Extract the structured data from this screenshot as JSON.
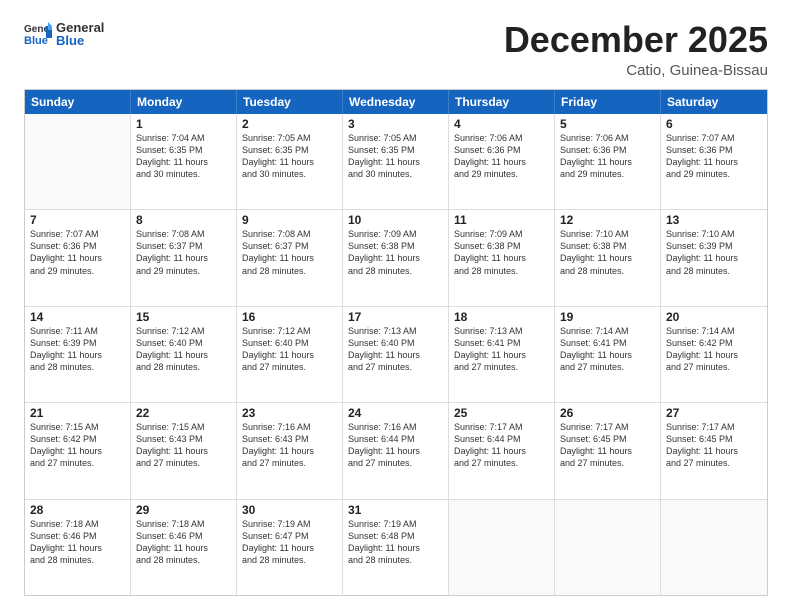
{
  "logo": {
    "general": "General",
    "blue": "Blue"
  },
  "header": {
    "month": "December 2025",
    "location": "Catio, Guinea-Bissau"
  },
  "weekdays": [
    "Sunday",
    "Monday",
    "Tuesday",
    "Wednesday",
    "Thursday",
    "Friday",
    "Saturday"
  ],
  "rows": [
    [
      {
        "day": "",
        "sunrise": "",
        "sunset": "",
        "daylight": "",
        "empty": true
      },
      {
        "day": "1",
        "sunrise": "Sunrise: 7:04 AM",
        "sunset": "Sunset: 6:35 PM",
        "daylight": "Daylight: 11 hours and 30 minutes."
      },
      {
        "day": "2",
        "sunrise": "Sunrise: 7:05 AM",
        "sunset": "Sunset: 6:35 PM",
        "daylight": "Daylight: 11 hours and 30 minutes."
      },
      {
        "day": "3",
        "sunrise": "Sunrise: 7:05 AM",
        "sunset": "Sunset: 6:35 PM",
        "daylight": "Daylight: 11 hours and 30 minutes."
      },
      {
        "day": "4",
        "sunrise": "Sunrise: 7:06 AM",
        "sunset": "Sunset: 6:36 PM",
        "daylight": "Daylight: 11 hours and 29 minutes."
      },
      {
        "day": "5",
        "sunrise": "Sunrise: 7:06 AM",
        "sunset": "Sunset: 6:36 PM",
        "daylight": "Daylight: 11 hours and 29 minutes."
      },
      {
        "day": "6",
        "sunrise": "Sunrise: 7:07 AM",
        "sunset": "Sunset: 6:36 PM",
        "daylight": "Daylight: 11 hours and 29 minutes."
      }
    ],
    [
      {
        "day": "7",
        "sunrise": "Sunrise: 7:07 AM",
        "sunset": "Sunset: 6:36 PM",
        "daylight": "Daylight: 11 hours and 29 minutes."
      },
      {
        "day": "8",
        "sunrise": "Sunrise: 7:08 AM",
        "sunset": "Sunset: 6:37 PM",
        "daylight": "Daylight: 11 hours and 29 minutes."
      },
      {
        "day": "9",
        "sunrise": "Sunrise: 7:08 AM",
        "sunset": "Sunset: 6:37 PM",
        "daylight": "Daylight: 11 hours and 28 minutes."
      },
      {
        "day": "10",
        "sunrise": "Sunrise: 7:09 AM",
        "sunset": "Sunset: 6:38 PM",
        "daylight": "Daylight: 11 hours and 28 minutes."
      },
      {
        "day": "11",
        "sunrise": "Sunrise: 7:09 AM",
        "sunset": "Sunset: 6:38 PM",
        "daylight": "Daylight: 11 hours and 28 minutes."
      },
      {
        "day": "12",
        "sunrise": "Sunrise: 7:10 AM",
        "sunset": "Sunset: 6:38 PM",
        "daylight": "Daylight: 11 hours and 28 minutes."
      },
      {
        "day": "13",
        "sunrise": "Sunrise: 7:10 AM",
        "sunset": "Sunset: 6:39 PM",
        "daylight": "Daylight: 11 hours and 28 minutes."
      }
    ],
    [
      {
        "day": "14",
        "sunrise": "Sunrise: 7:11 AM",
        "sunset": "Sunset: 6:39 PM",
        "daylight": "Daylight: 11 hours and 28 minutes."
      },
      {
        "day": "15",
        "sunrise": "Sunrise: 7:12 AM",
        "sunset": "Sunset: 6:40 PM",
        "daylight": "Daylight: 11 hours and 28 minutes."
      },
      {
        "day": "16",
        "sunrise": "Sunrise: 7:12 AM",
        "sunset": "Sunset: 6:40 PM",
        "daylight": "Daylight: 11 hours and 27 minutes."
      },
      {
        "day": "17",
        "sunrise": "Sunrise: 7:13 AM",
        "sunset": "Sunset: 6:40 PM",
        "daylight": "Daylight: 11 hours and 27 minutes."
      },
      {
        "day": "18",
        "sunrise": "Sunrise: 7:13 AM",
        "sunset": "Sunset: 6:41 PM",
        "daylight": "Daylight: 11 hours and 27 minutes."
      },
      {
        "day": "19",
        "sunrise": "Sunrise: 7:14 AM",
        "sunset": "Sunset: 6:41 PM",
        "daylight": "Daylight: 11 hours and 27 minutes."
      },
      {
        "day": "20",
        "sunrise": "Sunrise: 7:14 AM",
        "sunset": "Sunset: 6:42 PM",
        "daylight": "Daylight: 11 hours and 27 minutes."
      }
    ],
    [
      {
        "day": "21",
        "sunrise": "Sunrise: 7:15 AM",
        "sunset": "Sunset: 6:42 PM",
        "daylight": "Daylight: 11 hours and 27 minutes."
      },
      {
        "day": "22",
        "sunrise": "Sunrise: 7:15 AM",
        "sunset": "Sunset: 6:43 PM",
        "daylight": "Daylight: 11 hours and 27 minutes."
      },
      {
        "day": "23",
        "sunrise": "Sunrise: 7:16 AM",
        "sunset": "Sunset: 6:43 PM",
        "daylight": "Daylight: 11 hours and 27 minutes."
      },
      {
        "day": "24",
        "sunrise": "Sunrise: 7:16 AM",
        "sunset": "Sunset: 6:44 PM",
        "daylight": "Daylight: 11 hours and 27 minutes."
      },
      {
        "day": "25",
        "sunrise": "Sunrise: 7:17 AM",
        "sunset": "Sunset: 6:44 PM",
        "daylight": "Daylight: 11 hours and 27 minutes."
      },
      {
        "day": "26",
        "sunrise": "Sunrise: 7:17 AM",
        "sunset": "Sunset: 6:45 PM",
        "daylight": "Daylight: 11 hours and 27 minutes."
      },
      {
        "day": "27",
        "sunrise": "Sunrise: 7:17 AM",
        "sunset": "Sunset: 6:45 PM",
        "daylight": "Daylight: 11 hours and 27 minutes."
      }
    ],
    [
      {
        "day": "28",
        "sunrise": "Sunrise: 7:18 AM",
        "sunset": "Sunset: 6:46 PM",
        "daylight": "Daylight: 11 hours and 28 minutes."
      },
      {
        "day": "29",
        "sunrise": "Sunrise: 7:18 AM",
        "sunset": "Sunset: 6:46 PM",
        "daylight": "Daylight: 11 hours and 28 minutes."
      },
      {
        "day": "30",
        "sunrise": "Sunrise: 7:19 AM",
        "sunset": "Sunset: 6:47 PM",
        "daylight": "Daylight: 11 hours and 28 minutes."
      },
      {
        "day": "31",
        "sunrise": "Sunrise: 7:19 AM",
        "sunset": "Sunset: 6:48 PM",
        "daylight": "Daylight: 11 hours and 28 minutes."
      },
      {
        "day": "",
        "sunrise": "",
        "sunset": "",
        "daylight": "",
        "empty": true
      },
      {
        "day": "",
        "sunrise": "",
        "sunset": "",
        "daylight": "",
        "empty": true
      },
      {
        "day": "",
        "sunrise": "",
        "sunset": "",
        "daylight": "",
        "empty": true
      }
    ]
  ]
}
